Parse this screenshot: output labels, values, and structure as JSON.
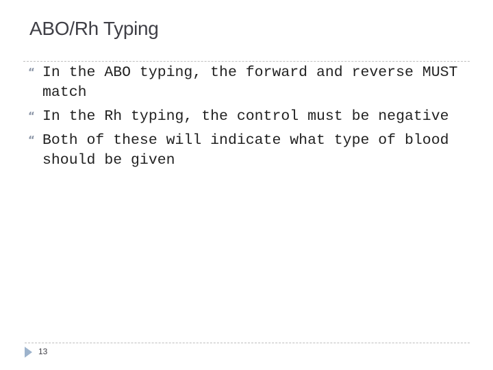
{
  "slide": {
    "title": "ABO/Rh Typing",
    "bullet_icon": "“",
    "bullets": [
      {
        "text": "In the ABO typing, the forward and reverse MUST match"
      },
      {
        "text": "In the Rh typing, the control must be negative"
      },
      {
        "text": "Both of these will indicate what type of blood should be given"
      }
    ],
    "footer": {
      "page_number": "13"
    }
  }
}
